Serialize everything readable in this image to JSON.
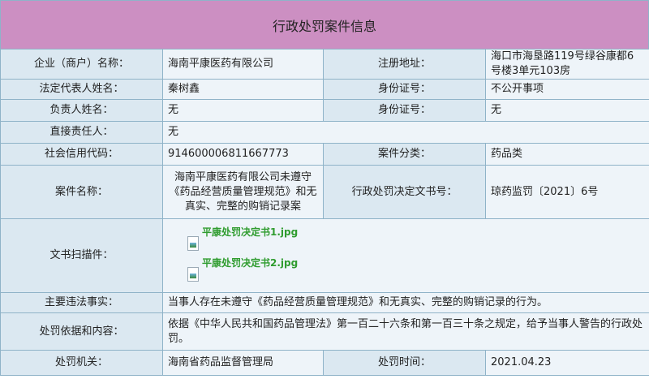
{
  "header": {
    "title": "行政处罚案件信息"
  },
  "rows": {
    "company_label": "企业（商户）名称：",
    "company_value": "海南平康医药有限公司",
    "address_label": "注册地址：",
    "address_value": "海口市海垦路119号绿谷康都6号楼3单元103房",
    "legal_rep_label": "法定代表人姓名：",
    "legal_rep_value": "秦树鑫",
    "id1_label": "身份证号：",
    "id1_value": "不公开事项",
    "responsible_label": "负责人姓名：",
    "responsible_value": "无",
    "id2_label": "身份证号：",
    "id2_value": "无",
    "direct_label": "直接责任人：",
    "direct_value": "无",
    "credit_label": "社会信用代码：",
    "credit_value": "914600006811667773",
    "category_label": "案件分类：",
    "category_value": "药品类",
    "case_name_label": "案件名称：",
    "case_name_value": "海南平康医药有限公司未遵守《药品经营质量管理规范》和无真实、完整的购销记录案",
    "decision_no_label": "行政处罚决定文书号：",
    "decision_no_value": "琼药监罚〔2021〕6号",
    "scan_label": "文书扫描件：",
    "attachments": [
      "平康处罚决定书1.jpg",
      "平康处罚决定书2.jpg"
    ],
    "facts_label": "主要违法事实：",
    "facts_value": "当事人存在未遵守《药品经营质量管理规范》和无真实、完整的购销记录的行为。",
    "basis_label": "处罚依据和内容：",
    "basis_value": "依据《中华人民共和国药品管理法》第一百二十六条和第一百三十条之规定，给予当事人警告的行政处罚。",
    "agency_label": "处罚机关：",
    "agency_value": "海南省药品监督管理局",
    "time_label": "处罚时间：",
    "time_value": "2021.04.23"
  },
  "colors": {
    "title_bg": "#cc8fc2",
    "label_bg": "#dbe8f1",
    "value_bg": "#eef4f9",
    "border": "#8fb3c8",
    "link": "#2f9c2f"
  }
}
